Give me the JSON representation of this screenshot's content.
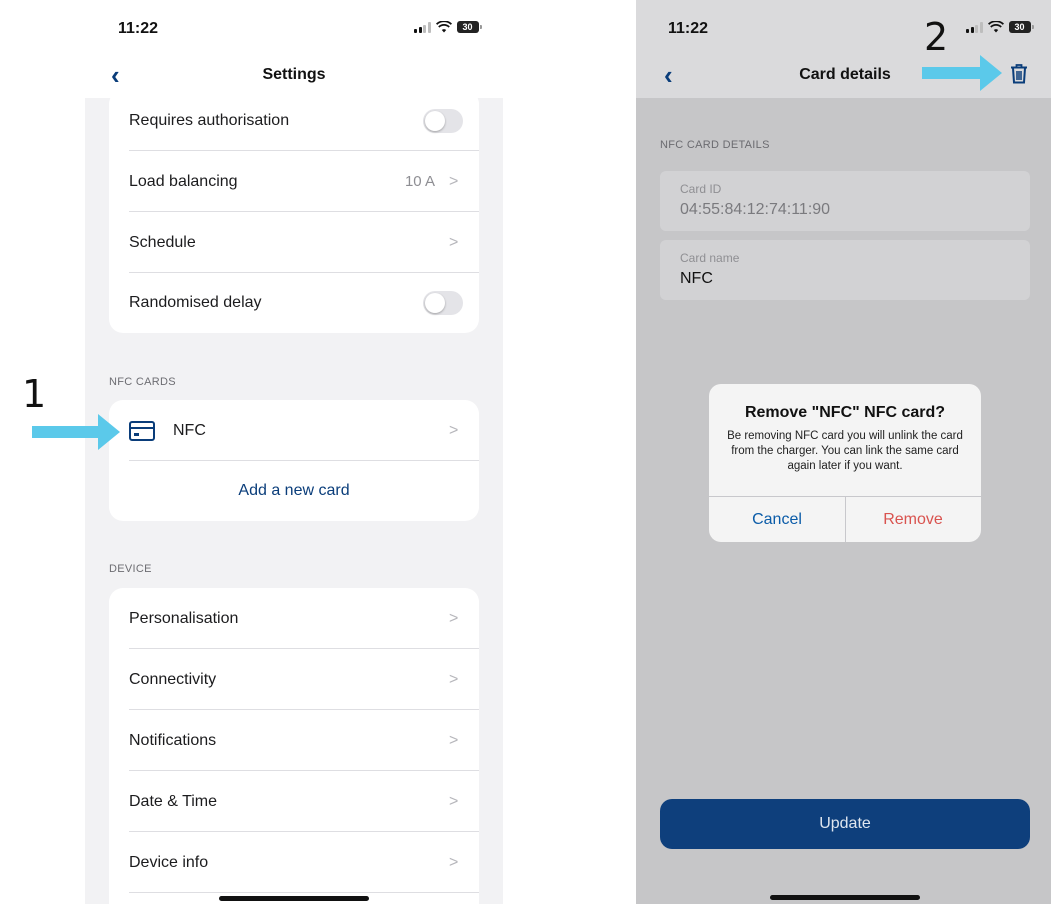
{
  "left": {
    "status": {
      "time": "11:22",
      "battery": "30"
    },
    "nav": {
      "back_icon": "chevron-left-icon",
      "title": "Settings"
    },
    "settings_rows": [
      {
        "label": "Requires authorisation",
        "control": "toggle",
        "on": false
      },
      {
        "label": "Load balancing",
        "value": "10 A"
      },
      {
        "label": "Schedule"
      },
      {
        "label": "Randomised delay",
        "control": "toggle",
        "on": false
      }
    ],
    "nfc_section": {
      "header": "NFC CARDS",
      "card_label": "NFC",
      "card_icon": "credit-card-icon",
      "add_label": "Add a new card"
    },
    "device_section": {
      "header": "DEVICE",
      "items": [
        {
          "label": "Personalisation"
        },
        {
          "label": "Connectivity"
        },
        {
          "label": "Notifications"
        },
        {
          "label": "Date & Time"
        },
        {
          "label": "Device info"
        }
      ]
    },
    "chevron": ">"
  },
  "right": {
    "status": {
      "time": "11:22",
      "battery": "30"
    },
    "nav": {
      "back_icon": "chevron-left-icon",
      "title": "Card details",
      "delete_icon": "trash-icon"
    },
    "section_header": "NFC CARD DETAILS",
    "fields": [
      {
        "label": "Card ID",
        "value": "04:55:84:12:74:11:90"
      },
      {
        "label": "Card name",
        "value": "NFC"
      }
    ],
    "dialog": {
      "title": "Remove \"NFC\" NFC card?",
      "message": "Be removing NFC card you will unlink the card from the charger. You can link the same card again later if you want.",
      "cancel": "Cancel",
      "remove": "Remove"
    },
    "update_button": "Update"
  },
  "annotations": {
    "step1": "1",
    "step2": "2",
    "arrow_color": "#5bc9ea"
  },
  "colors": {
    "accent": "#0a3d7a",
    "danger": "#d9534f",
    "update_bg": "#0e3f7c"
  }
}
